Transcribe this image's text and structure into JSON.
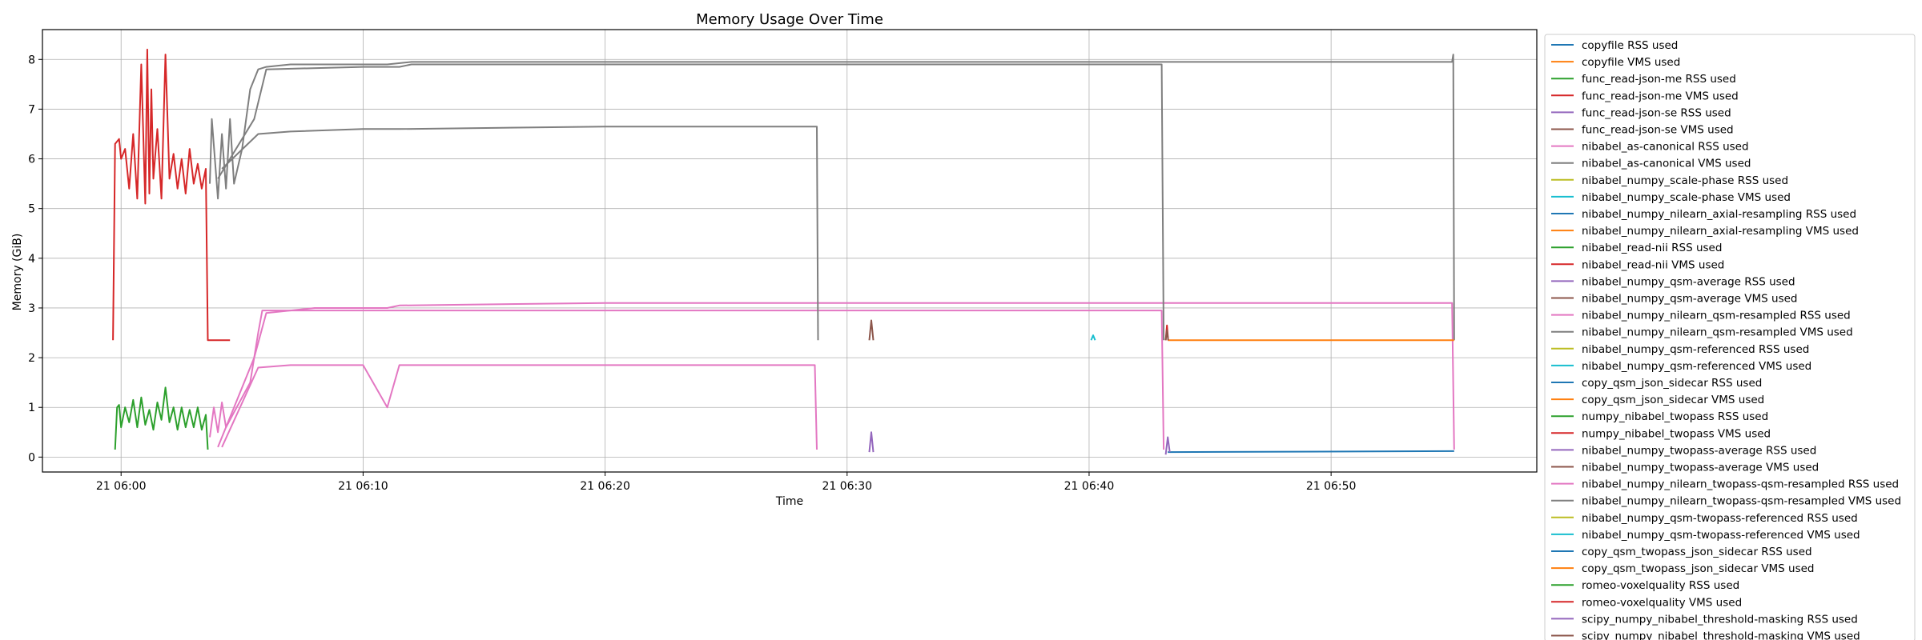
{
  "chart_data": {
    "type": "line",
    "title": "Memory Usage Over Time",
    "xlabel": "Time",
    "ylabel": "Memory (GiB)",
    "x_unit": "HH:MM on day 21",
    "xlim": [
      "05:56:45",
      "06:58:30"
    ],
    "ylim": [
      -0.3,
      8.6
    ],
    "x_ticks": [
      {
        "t": "06:00",
        "label": "21 06:00"
      },
      {
        "t": "06:10",
        "label": "21 06:10"
      },
      {
        "t": "06:20",
        "label": "21 06:20"
      },
      {
        "t": "06:30",
        "label": "21 06:30"
      },
      {
        "t": "06:40",
        "label": "21 06:40"
      },
      {
        "t": "06:50",
        "label": "21 06:50"
      }
    ],
    "y_ticks": [
      0,
      1,
      2,
      3,
      4,
      5,
      6,
      7,
      8
    ],
    "grid": true,
    "legend_position": "outside right",
    "colors": [
      "#1f77b4",
      "#ff7f0e",
      "#2ca02c",
      "#d62728",
      "#9467bd",
      "#8c564b",
      "#e377c2",
      "#7f7f7f",
      "#bcbd22",
      "#17becf"
    ],
    "series": [
      {
        "name": "copyfile RSS used",
        "color": "#1f77b4",
        "points": []
      },
      {
        "name": "copyfile VMS used",
        "color": "#ff7f0e",
        "points": []
      },
      {
        "name": "func_read-json-me RSS used",
        "color": "#2ca02c",
        "points": [
          [
            "05:59:45",
            0.15
          ],
          [
            "05:59:50",
            1.0
          ],
          [
            "05:59:55",
            1.05
          ],
          [
            "06:00:00",
            0.6
          ],
          [
            "06:00:10",
            1.0
          ],
          [
            "06:00:20",
            0.7
          ],
          [
            "06:00:30",
            1.15
          ],
          [
            "06:00:40",
            0.6
          ],
          [
            "06:00:50",
            1.2
          ],
          [
            "06:01:00",
            0.65
          ],
          [
            "06:01:10",
            0.95
          ],
          [
            "06:01:20",
            0.55
          ],
          [
            "06:01:30",
            1.1
          ],
          [
            "06:01:40",
            0.75
          ],
          [
            "06:01:50",
            1.4
          ],
          [
            "06:02:00",
            0.7
          ],
          [
            "06:02:10",
            1.0
          ],
          [
            "06:02:20",
            0.55
          ],
          [
            "06:02:30",
            1.0
          ],
          [
            "06:02:40",
            0.6
          ],
          [
            "06:02:50",
            0.95
          ],
          [
            "06:03:00",
            0.6
          ],
          [
            "06:03:10",
            1.0
          ],
          [
            "06:03:20",
            0.55
          ],
          [
            "06:03:30",
            0.85
          ],
          [
            "06:03:35",
            0.15
          ]
        ]
      },
      {
        "name": "func_read-json-me VMS used",
        "color": "#d62728",
        "points": [
          [
            "05:59:40",
            2.35
          ],
          [
            "05:59:45",
            6.3
          ],
          [
            "05:59:55",
            6.4
          ],
          [
            "06:00:00",
            6.0
          ],
          [
            "06:00:10",
            6.2
          ],
          [
            "06:00:20",
            5.4
          ],
          [
            "06:00:30",
            6.5
          ],
          [
            "06:00:40",
            5.2
          ],
          [
            "06:00:50",
            7.9
          ],
          [
            "06:01:00",
            5.1
          ],
          [
            "06:01:05",
            8.2
          ],
          [
            "06:01:10",
            5.3
          ],
          [
            "06:01:15",
            7.4
          ],
          [
            "06:01:20",
            5.6
          ],
          [
            "06:01:30",
            6.6
          ],
          [
            "06:01:40",
            5.2
          ],
          [
            "06:01:50",
            8.1
          ],
          [
            "06:02:00",
            5.6
          ],
          [
            "06:02:10",
            6.1
          ],
          [
            "06:02:20",
            5.4
          ],
          [
            "06:02:30",
            6.0
          ],
          [
            "06:02:40",
            5.3
          ],
          [
            "06:02:50",
            6.2
          ],
          [
            "06:03:00",
            5.5
          ],
          [
            "06:03:10",
            5.9
          ],
          [
            "06:03:20",
            5.4
          ],
          [
            "06:03:30",
            5.8
          ],
          [
            "06:03:35",
            2.35
          ],
          [
            "06:04:30",
            2.35
          ]
        ]
      },
      {
        "name": "func_read-json-se RSS used",
        "color": "#9467bd",
        "points": []
      },
      {
        "name": "func_read-json-se VMS used",
        "color": "#8c564b",
        "points": []
      },
      {
        "name": "nibabel_as-canonical RSS used",
        "color": "#e377c2",
        "points": [
          [
            "06:03:40",
            0.4
          ],
          [
            "06:03:50",
            1.0
          ],
          [
            "06:04:00",
            0.5
          ],
          [
            "06:04:10",
            1.1
          ],
          [
            "06:04:20",
            0.6
          ],
          [
            "06:04:40",
            0.9
          ],
          [
            "06:05:00",
            1.2
          ],
          [
            "06:05:20",
            1.5
          ],
          [
            "06:05:40",
            2.5
          ],
          [
            "06:05:50",
            2.95
          ],
          [
            "06:06:30",
            2.95
          ],
          [
            "06:07:00",
            2.95
          ],
          [
            "06:08:00",
            3.0
          ],
          [
            "06:10:00",
            3.0
          ],
          [
            "06:11:00",
            3.0
          ],
          [
            "06:11:30",
            3.05
          ],
          [
            "06:20:00",
            3.1
          ],
          [
            "06:30:00",
            3.1
          ],
          [
            "06:40:00",
            3.1
          ],
          [
            "06:55:00",
            3.1
          ],
          [
            "06:55:05",
            0.15
          ]
        ]
      },
      {
        "name": "nibabel_as-canonical VMS used",
        "color": "#7f7f7f",
        "points": [
          [
            "06:03:40",
            5.5
          ],
          [
            "06:03:45",
            6.8
          ],
          [
            "06:04:00",
            5.2
          ],
          [
            "06:04:10",
            6.5
          ],
          [
            "06:04:20",
            5.4
          ],
          [
            "06:04:30",
            6.8
          ],
          [
            "06:04:40",
            5.5
          ],
          [
            "06:05:00",
            6.2
          ],
          [
            "06:05:20",
            7.4
          ],
          [
            "06:05:40",
            7.8
          ],
          [
            "06:06:00",
            7.85
          ],
          [
            "06:07:00",
            7.9
          ],
          [
            "06:09:00",
            7.9
          ],
          [
            "06:11:00",
            7.9
          ],
          [
            "06:12:00",
            7.95
          ],
          [
            "06:30:00",
            7.95
          ],
          [
            "06:43:00",
            7.95
          ],
          [
            "06:55:00",
            7.95
          ],
          [
            "06:55:03",
            8.1
          ],
          [
            "06:55:05",
            2.35
          ]
        ]
      },
      {
        "name": "nibabel_numpy_scale-phase RSS used",
        "color": "#bcbd22",
        "points": []
      },
      {
        "name": "nibabel_numpy_scale-phase VMS used",
        "color": "#17becf",
        "points": []
      },
      {
        "name": "nibabel_numpy_nilearn_axial-resampling RSS used",
        "color": "#1f77b4",
        "points": [
          [
            "06:43:15",
            0.1
          ],
          [
            "06:55:05",
            0.12
          ]
        ]
      },
      {
        "name": "nibabel_numpy_nilearn_axial-resampling VMS used",
        "color": "#ff7f0e",
        "points": [
          [
            "06:43:15",
            2.35
          ],
          [
            "06:55:05",
            2.35
          ]
        ]
      },
      {
        "name": "nibabel_read-nii RSS used",
        "color": "#2ca02c",
        "points": []
      },
      {
        "name": "nibabel_read-nii VMS used",
        "color": "#d62728",
        "points": []
      },
      {
        "name": "nibabel_numpy_qsm-average RSS used",
        "color": "#9467bd",
        "points": [
          [
            "06:30:55",
            0.1
          ],
          [
            "06:31:00",
            0.5
          ],
          [
            "06:31:05",
            0.1
          ]
        ]
      },
      {
        "name": "nibabel_numpy_qsm-average VMS used",
        "color": "#8c564b",
        "points": [
          [
            "06:30:55",
            2.35
          ],
          [
            "06:31:00",
            2.75
          ],
          [
            "06:31:05",
            2.35
          ]
        ]
      },
      {
        "name": "nibabel_numpy_nilearn_qsm-resampled RSS used",
        "color": "#e377c2",
        "points": [
          [
            "06:04:00",
            0.2
          ],
          [
            "06:05:30",
            2.0
          ],
          [
            "06:06:00",
            2.9
          ],
          [
            "06:07:00",
            2.95
          ],
          [
            "06:10:00",
            2.95
          ],
          [
            "06:11:00",
            2.95
          ],
          [
            "06:12:00",
            2.95
          ],
          [
            "06:20:00",
            2.95
          ],
          [
            "06:30:00",
            2.95
          ],
          [
            "06:40:00",
            2.95
          ],
          [
            "06:43:00",
            2.95
          ],
          [
            "06:43:05",
            0.15
          ]
        ]
      },
      {
        "name": "nibabel_numpy_nilearn_qsm-resampled VMS used",
        "color": "#7f7f7f",
        "points": [
          [
            "06:04:00",
            5.6
          ],
          [
            "06:05:30",
            6.8
          ],
          [
            "06:06:00",
            7.8
          ],
          [
            "06:10:00",
            7.85
          ],
          [
            "06:11:30",
            7.85
          ],
          [
            "06:12:00",
            7.9
          ],
          [
            "06:30:00",
            7.9
          ],
          [
            "06:43:00",
            7.9
          ],
          [
            "06:43:05",
            2.35
          ]
        ]
      },
      {
        "name": "nibabel_numpy_qsm-referenced RSS used",
        "color": "#bcbd22",
        "points": []
      },
      {
        "name": "nibabel_numpy_qsm-referenced VMS used",
        "color": "#17becf",
        "points": [
          [
            "06:40:05",
            2.35
          ],
          [
            "06:40:10",
            2.45
          ],
          [
            "06:40:15",
            2.35
          ]
        ]
      },
      {
        "name": "copy_qsm_json_sidecar RSS used",
        "color": "#1f77b4",
        "points": []
      },
      {
        "name": "copy_qsm_json_sidecar VMS used",
        "color": "#ff7f0e",
        "points": []
      },
      {
        "name": "numpy_nibabel_twopass RSS used",
        "color": "#2ca02c",
        "points": []
      },
      {
        "name": "numpy_nibabel_twopass VMS used",
        "color": "#d62728",
        "points": [
          [
            "06:43:10",
            2.35
          ],
          [
            "06:43:13",
            2.65
          ],
          [
            "06:43:16",
            2.35
          ]
        ]
      },
      {
        "name": "nibabel_numpy_twopass-average RSS used",
        "color": "#9467bd",
        "points": [
          [
            "06:43:10",
            0.05
          ],
          [
            "06:43:15",
            0.4
          ],
          [
            "06:43:20",
            0.1
          ]
        ]
      },
      {
        "name": "nibabel_numpy_twopass-average VMS used",
        "color": "#8c564b",
        "points": [
          [
            "06:43:10",
            2.35
          ],
          [
            "06:43:13",
            2.55
          ],
          [
            "06:43:16",
            2.35
          ]
        ]
      },
      {
        "name": "nibabel_numpy_nilearn_twopass-qsm-resampled RSS used",
        "color": "#e377c2",
        "points": [
          [
            "06:04:10",
            0.2
          ],
          [
            "06:05:40",
            1.8
          ],
          [
            "06:07:00",
            1.85
          ],
          [
            "06:10:00",
            1.85
          ],
          [
            "06:11:00",
            1.0
          ],
          [
            "06:11:30",
            1.85
          ],
          [
            "06:20:00",
            1.85
          ],
          [
            "06:28:00",
            1.85
          ],
          [
            "06:28:40",
            1.85
          ],
          [
            "06:28:45",
            0.15
          ]
        ]
      },
      {
        "name": "nibabel_numpy_nilearn_twopass-qsm-resampled VMS used",
        "color": "#7f7f7f",
        "points": [
          [
            "06:04:10",
            5.8
          ],
          [
            "06:05:40",
            6.5
          ],
          [
            "06:07:00",
            6.55
          ],
          [
            "06:10:00",
            6.6
          ],
          [
            "06:11:30",
            6.6
          ],
          [
            "06:20:00",
            6.65
          ],
          [
            "06:28:00",
            6.65
          ],
          [
            "06:28:45",
            6.65
          ],
          [
            "06:28:48",
            2.35
          ]
        ]
      },
      {
        "name": "nibabel_numpy_qsm-twopass-referenced RSS used",
        "color": "#bcbd22",
        "points": []
      },
      {
        "name": "nibabel_numpy_qsm-twopass-referenced VMS used",
        "color": "#17becf",
        "points": []
      },
      {
        "name": "copy_qsm_twopass_json_sidecar RSS used",
        "color": "#1f77b4",
        "points": []
      },
      {
        "name": "copy_qsm_twopass_json_sidecar VMS used",
        "color": "#ff7f0e",
        "points": []
      },
      {
        "name": "romeo-voxelquality RSS used",
        "color": "#2ca02c",
        "points": []
      },
      {
        "name": "romeo-voxelquality VMS used",
        "color": "#d62728",
        "points": []
      },
      {
        "name": "scipy_numpy_nibabel_threshold-masking RSS used",
        "color": "#9467bd",
        "points": []
      },
      {
        "name": "scipy_numpy_nibabel_threshold-masking VMS used",
        "color": "#8c564b",
        "points": []
      }
    ]
  }
}
